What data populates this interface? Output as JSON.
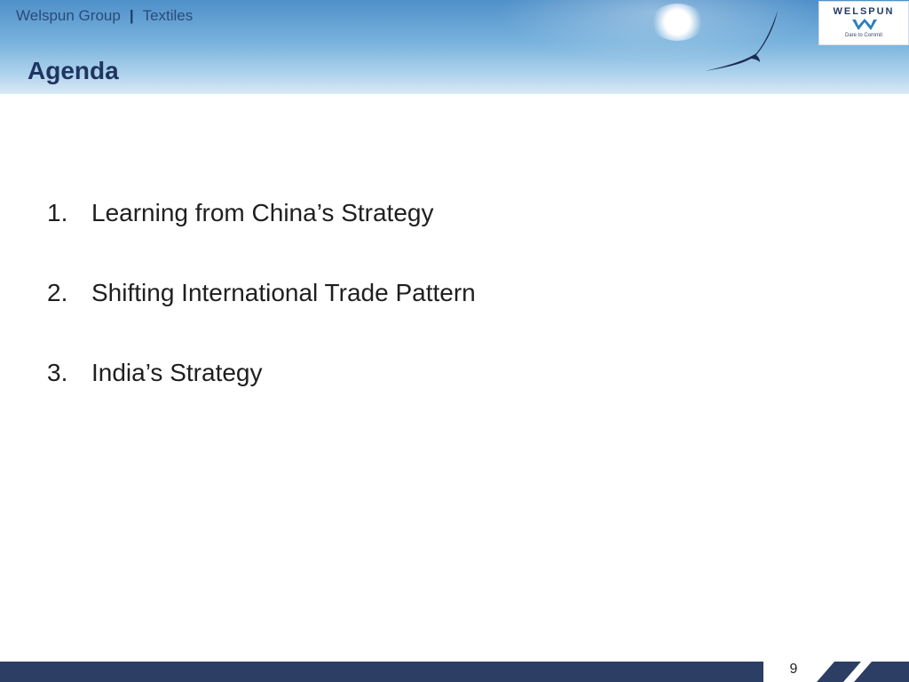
{
  "header": {
    "brand": "Welspun Group",
    "separator": "|",
    "section": "Textiles"
  },
  "slide": {
    "title": "Agenda",
    "items": [
      {
        "number": "1.",
        "text": "Learning from China’s Strategy"
      },
      {
        "number": "2.",
        "text": "Shifting International Trade Pattern"
      },
      {
        "number": "3.",
        "text": "India’s Strategy"
      }
    ],
    "page_number": "9"
  },
  "logo": {
    "wordmark": "WELSPUN",
    "tagline": "Dare to Commit"
  },
  "colors": {
    "title": "#1f3560",
    "footer_bar": "#2c3e63",
    "header_sky_top": "#4f90c9"
  },
  "icons": [
    "bird-icon",
    "welspun-logo-mark-icon"
  ]
}
